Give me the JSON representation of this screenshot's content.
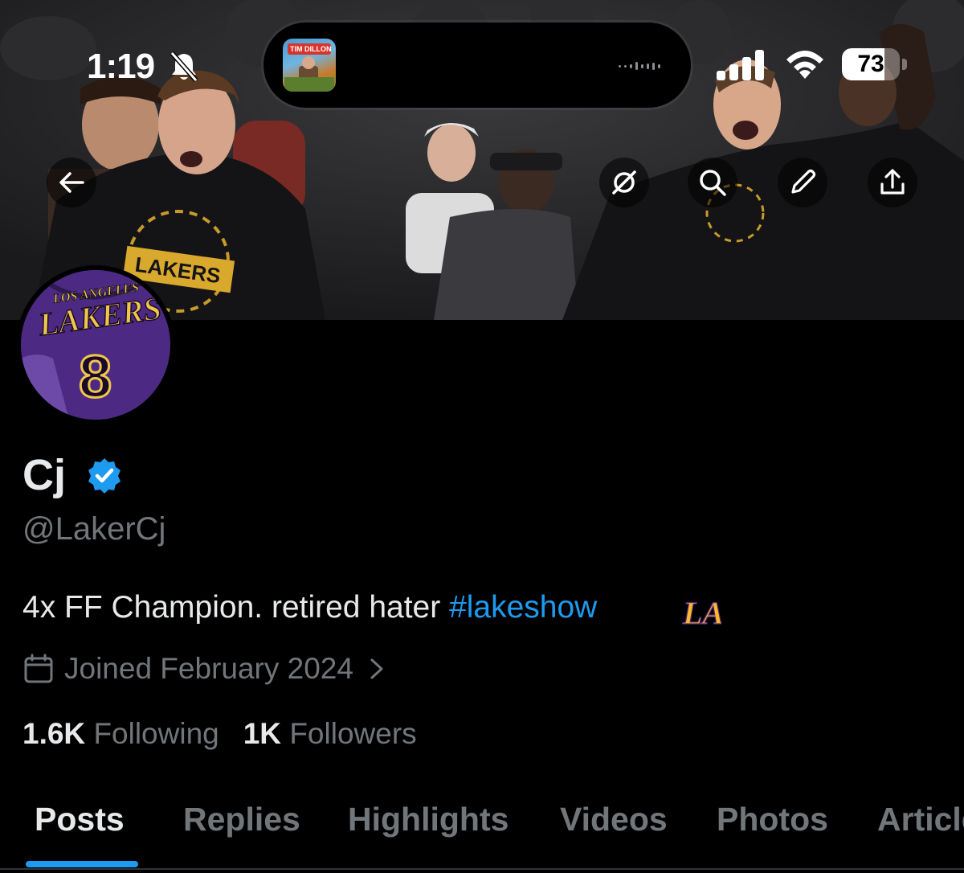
{
  "status_bar": {
    "time": "1:19",
    "battery_level": "73",
    "battery_fraction": 0.73,
    "silent_icon": "bell-slash-icon",
    "live_activity_badge": "TIM DILLON"
  },
  "header": {
    "back_icon": "back-arrow-icon",
    "grok_icon": "grok-icon",
    "search_icon": "search-icon",
    "edit_icon": "pencil-icon",
    "share_icon": "share-icon"
  },
  "banner": {
    "shirt_text": "LAKERS"
  },
  "avatar": {
    "jersey_top": "LOS ANGELES",
    "jersey_team": "LAKERS",
    "jersey_number": "8"
  },
  "profile": {
    "name": "Cj",
    "handle": "@LakerCj",
    "bio_text": "4x FF Champion. retired hater ",
    "bio_hashtag": "#lakeshow",
    "bio_logo": "LA",
    "joined": "Joined February 2024",
    "following_count": "1.6K",
    "following_label": "Following",
    "followers_count": "1K",
    "followers_label": "Followers"
  },
  "tabs": [
    {
      "label": "Posts",
      "active": true
    },
    {
      "label": "Replies",
      "active": false
    },
    {
      "label": "Highlights",
      "active": false
    },
    {
      "label": "Videos",
      "active": false
    },
    {
      "label": "Photos",
      "active": false
    },
    {
      "label": "Articles",
      "active": false
    }
  ],
  "colors": {
    "accent": "#1d9bf0",
    "text_primary": "#e7e9ea",
    "text_secondary": "#71767b",
    "lakers_purple": "#552583",
    "lakers_gold": "#fdb927"
  }
}
